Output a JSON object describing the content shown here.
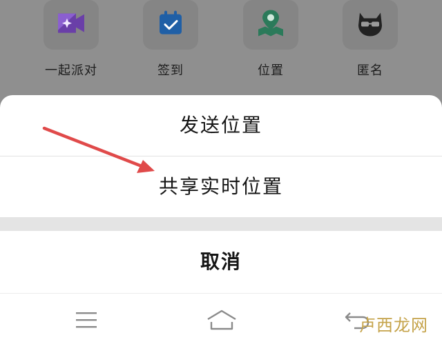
{
  "background_apps": [
    {
      "label": "一起派对",
      "icon": "party-video-icon",
      "color": "#7f4cc4"
    },
    {
      "label": "签到",
      "icon": "calendar-check-icon",
      "color": "#2474c9"
    },
    {
      "label": "位置",
      "icon": "map-pin-icon",
      "color": "#2f8f6a"
    },
    {
      "label": "匿名",
      "icon": "cat-mask-icon",
      "color": "#2b2b2b"
    }
  ],
  "sheet": {
    "send_location": "发送位置",
    "share_live_location": "共享实时位置",
    "cancel": "取消"
  },
  "nav": {
    "menu_icon": "menu-icon",
    "home_icon": "home-icon",
    "back_icon": "back-icon"
  },
  "annotation": {
    "arrow_color": "#e04a4a"
  },
  "watermark": "卢西龙网"
}
